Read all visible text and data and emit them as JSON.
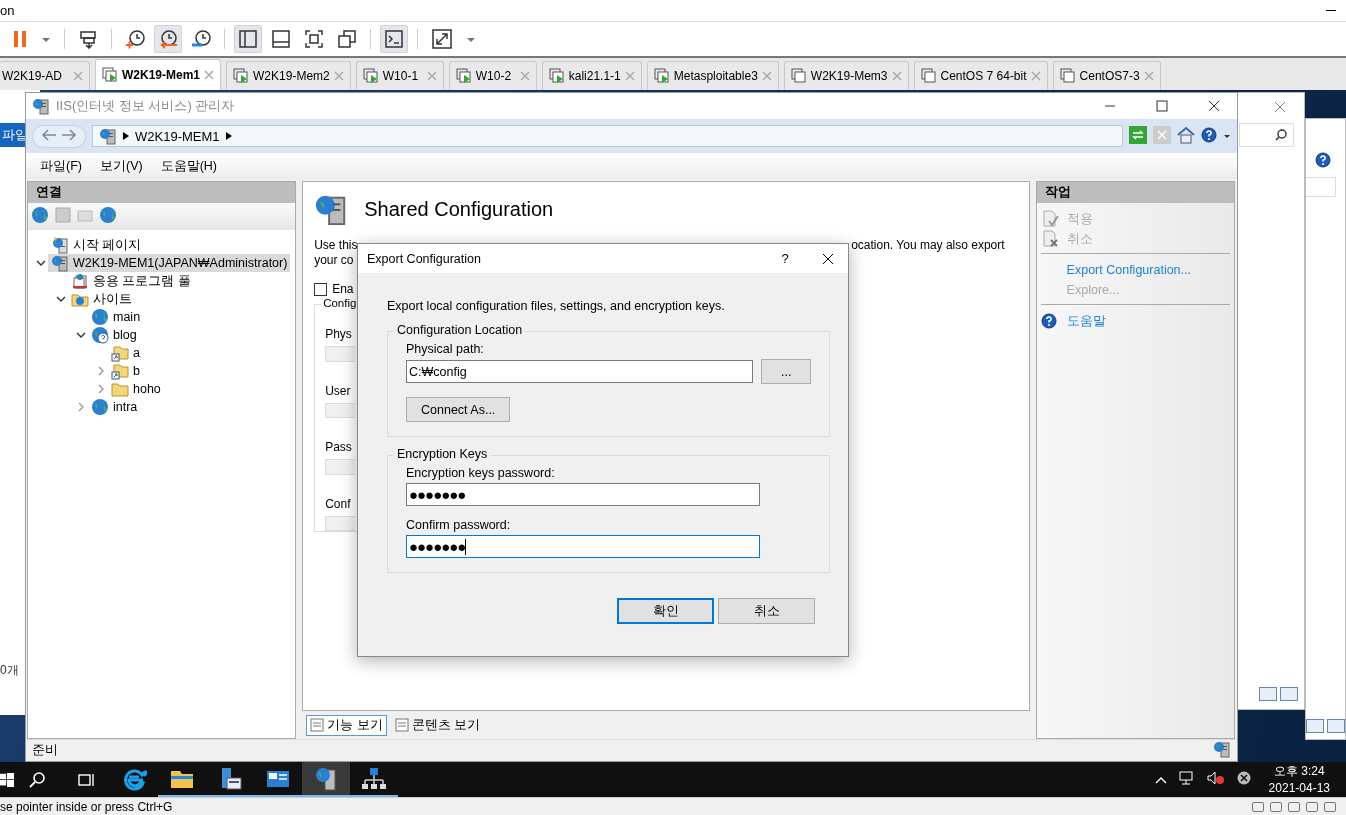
{
  "host": {
    "title_fragment": "on",
    "toolbar": [
      {
        "kind": "pause",
        "pressed": false
      },
      {
        "kind": "caret",
        "pressed": false
      },
      {
        "kind": "send-keys",
        "pressed": false
      },
      {
        "kind": "snapshot-add",
        "pressed": false
      },
      {
        "kind": "snapshot-revert",
        "pressed": true
      },
      {
        "kind": "snapshot-manage",
        "pressed": false
      },
      {
        "kind": "sidebar",
        "pressed": true
      },
      {
        "kind": "bottom-panel",
        "pressed": false
      },
      {
        "kind": "fullscreen",
        "pressed": false
      },
      {
        "kind": "unity",
        "pressed": false
      },
      {
        "kind": "console",
        "pressed": true
      },
      {
        "kind": "stretch",
        "pressed": false
      },
      {
        "kind": "caret",
        "pressed": false
      }
    ],
    "tabs": [
      {
        "label": "W2K19-AD",
        "selected": false
      },
      {
        "label": "W2K19-Mem1",
        "selected": true,
        "running": true
      },
      {
        "label": "W2K19-Mem2",
        "selected": false,
        "running": true
      },
      {
        "label": "W10-1",
        "selected": false,
        "running": true
      },
      {
        "label": "W10-2",
        "selected": false,
        "running": true
      },
      {
        "label": "kali21.1-1",
        "selected": false,
        "running": true
      },
      {
        "label": "Metasploitable3",
        "selected": false,
        "running": true
      },
      {
        "label": "W2K19-Mem3",
        "selected": false,
        "running": false
      },
      {
        "label": "CentOS 7 64-bit",
        "selected": false,
        "running": false
      },
      {
        "label": "CentOS7-3",
        "selected": false,
        "running": false
      }
    ],
    "status_text": "se pointer inside or press Ctrl+G"
  },
  "background_window": {
    "ribbon_tab": "파일",
    "status_fragment": "0개"
  },
  "iis": {
    "title": "IIS(인터넷 정보 서비스) 관리자",
    "breadcrumb": [
      "W2K19-MEM1"
    ],
    "menu": [
      "파일(F)",
      "보기(V)",
      "도움말(H)"
    ],
    "connections": {
      "title": "연결",
      "tree": [
        {
          "label": "시작 페이지",
          "kind": "start-page",
          "selected": false
        },
        {
          "label": "W2K19-MEM1(JAPAN₩Administrator)",
          "kind": "server",
          "selected": true,
          "expanded": true,
          "children": [
            {
              "label": "응용 프로그램 풀",
              "kind": "app-pools",
              "selected": false
            },
            {
              "label": "사이트",
              "kind": "sites",
              "selected": false,
              "expanded": true,
              "children": [
                {
                  "label": "main",
                  "kind": "site",
                  "selected": false
                },
                {
                  "label": "blog",
                  "kind": "site-help",
                  "selected": false,
                  "expanded": true,
                  "children": [
                    {
                      "label": "a",
                      "kind": "virtual-dir",
                      "selected": false
                    },
                    {
                      "label": "b",
                      "kind": "virtual-dir",
                      "selected": false,
                      "expanded": false
                    },
                    {
                      "label": "hoho",
                      "kind": "folder",
                      "selected": false,
                      "expanded": false
                    }
                  ]
                },
                {
                  "label": "intra",
                  "kind": "site",
                  "selected": false,
                  "expanded": false
                }
              ]
            }
          ]
        }
      ]
    },
    "feature": {
      "title": "Shared Configuration",
      "description_left": [
        "Use this",
        "your co"
      ],
      "description_right": "ocation. You may also export",
      "checkbox": {
        "label": "Ena",
        "checked": false
      },
      "group_title": "Config",
      "field_labels": [
        "Phys",
        "User",
        "Pass",
        "Conf"
      ],
      "views": [
        {
          "label": "기능 보기",
          "selected": true
        },
        {
          "label": "콘텐츠 보기",
          "selected": false
        }
      ]
    },
    "actions": {
      "title": "작업",
      "groups": [
        [
          {
            "label": "적용",
            "kind": "apply",
            "disabled": true
          },
          {
            "label": "취소",
            "kind": "cancel",
            "disabled": true
          }
        ],
        [
          {
            "label": "Export Configuration...",
            "kind": "plain",
            "disabled": false
          },
          {
            "label": "Explore...",
            "kind": "plain",
            "disabled": true
          }
        ],
        [
          {
            "label": "도움말",
            "kind": "help",
            "disabled": false
          }
        ]
      ]
    },
    "status": "준비"
  },
  "dialog": {
    "title": "Export Configuration",
    "help": "?",
    "intro": "Export local configuration files, settings, and encryption keys.",
    "location": {
      "title": "Configuration Location",
      "path_label": "Physical path:",
      "path_value": "C:₩config",
      "browse": "...",
      "connect": "Connect As..."
    },
    "keys": {
      "title": "Encryption Keys",
      "password_label": "Encryption keys password:",
      "password_value": "●●●●●●●",
      "confirm_label": "Confirm password:",
      "confirm_value": "●●●●●●●"
    },
    "buttons": [
      {
        "label": "확인",
        "default": true
      },
      {
        "label": "취소",
        "default": false
      }
    ]
  },
  "taskbar": {
    "apps": [
      {
        "kind": "ie",
        "running": false,
        "selected": false
      },
      {
        "kind": "explorer",
        "running": true,
        "selected": false
      },
      {
        "kind": "server-manager",
        "running": true,
        "selected": false
      },
      {
        "kind": "control-panel",
        "running": true,
        "selected": false
      },
      {
        "kind": "iis",
        "running": true,
        "selected": true
      },
      {
        "kind": "network",
        "running": true,
        "selected": false
      }
    ],
    "time": "오후 3:24",
    "date": "2021-04-13"
  }
}
